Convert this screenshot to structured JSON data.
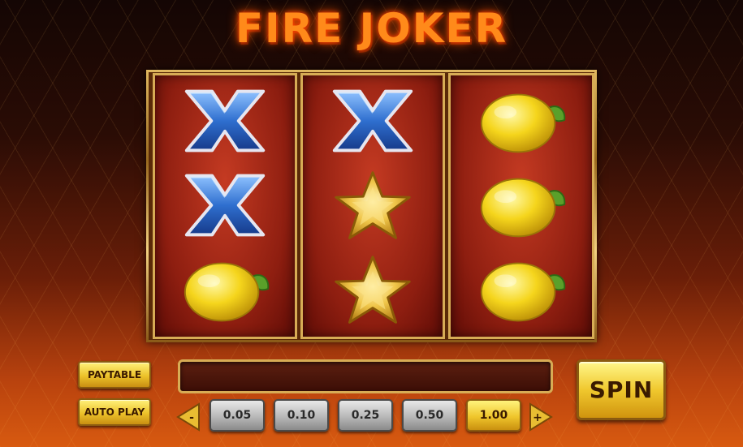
{
  "game": {
    "title": "FIRE JOKER"
  },
  "reels": [
    {
      "symbols": [
        "x",
        "x",
        "lemon"
      ]
    },
    {
      "symbols": [
        "x",
        "star",
        "star"
      ]
    },
    {
      "symbols": [
        "lemon",
        "lemon",
        "lemon"
      ]
    }
  ],
  "controls": {
    "paytable_label": "PAYTABLE",
    "autoplay_label": "AUTO PLAY",
    "spin_label": "SPIN",
    "minus_label": "-",
    "plus_label": "+",
    "message": ""
  },
  "bets": {
    "options": [
      "0.05",
      "0.10",
      "0.25",
      "0.50",
      "1.00"
    ],
    "selected": "1.00"
  },
  "colors": {
    "title": "#ff8a1a",
    "gold": "#d7ac55",
    "reel_red": "#8e1e10",
    "x_blue": "#3f7fd8",
    "lemon_yellow": "#f5d51c",
    "star_gold": "#f0c64a"
  }
}
